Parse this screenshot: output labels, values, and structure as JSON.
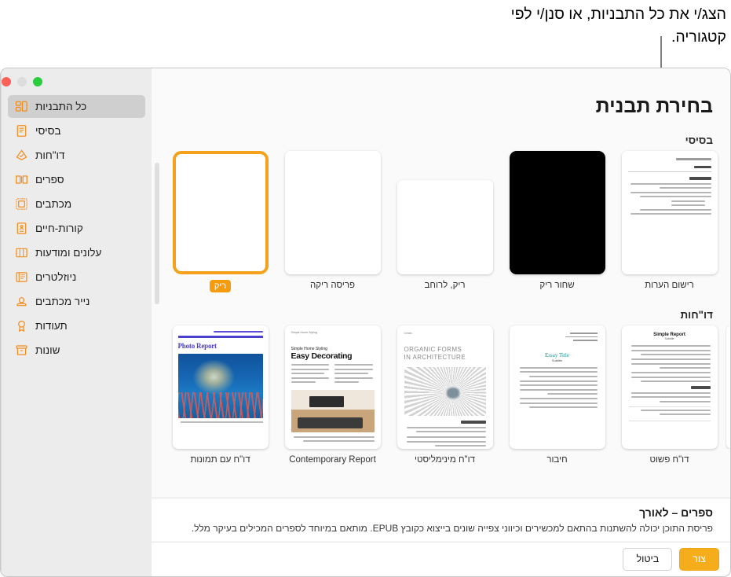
{
  "callout": {
    "text": "הצג/י את כל התבניות, או סנן/י לפי קטגוריה."
  },
  "window": {
    "traffic_lights": {
      "close": "close",
      "minimize": "minimize",
      "zoom": "zoom"
    }
  },
  "sidebar": {
    "items": [
      {
        "label": "כל התבניות",
        "icon": "all-templates-icon",
        "selected": true
      },
      {
        "label": "בסיסי",
        "icon": "basic-document-icon",
        "selected": false
      },
      {
        "label": "דו\"חות",
        "icon": "reports-icon",
        "selected": false
      },
      {
        "label": "ספרים",
        "icon": "books-icon",
        "selected": false
      },
      {
        "label": "מכתבים",
        "icon": "letters-icon",
        "selected": false
      },
      {
        "label": "קורות-חיים",
        "icon": "resume-icon",
        "selected": false
      },
      {
        "label": "עלונים ומודעות",
        "icon": "flyers-posters-icon",
        "selected": false
      },
      {
        "label": "ניוזלטרים",
        "icon": "newsletters-icon",
        "selected": false
      },
      {
        "label": "נייר מכתבים",
        "icon": "stationery-icon",
        "selected": false
      },
      {
        "label": "תעודות",
        "icon": "certificates-icon",
        "selected": false
      },
      {
        "label": "שונות",
        "icon": "miscellaneous-icon",
        "selected": false
      }
    ]
  },
  "main": {
    "title": "בחירת תבנית",
    "sections": [
      {
        "heading": "בסיסי",
        "templates": [
          {
            "label": "רישום הערות",
            "selected": false
          },
          {
            "label": "שחור ריק",
            "selected": false
          },
          {
            "label": "ריק, לרוחב",
            "selected": false
          },
          {
            "label": "פריסה ריקה",
            "selected": false
          },
          {
            "label": "ריק",
            "selected": true
          }
        ]
      },
      {
        "heading": "דו\"חות",
        "templates": [
          {
            "label": "דו\"ח עם תמונות",
            "selected": false
          },
          {
            "label": "Contemporary Report",
            "selected": false
          },
          {
            "label": "דו\"ח מינימליסטי",
            "selected": false
          },
          {
            "label": "חיבור",
            "selected": false
          },
          {
            "label": "דו\"ח פשוט",
            "selected": false
          }
        ]
      }
    ]
  },
  "footer": {
    "title": "ספרים – לאורך",
    "description": "פריסת התוכן יכולה להשתנות בהתאם למכשירים וכיווני צפייה שונים בייצוא כקובץ EPUB. מותאם במיוחד לספרים המכילים בעיקר מלל.",
    "create_label": "צור",
    "cancel_label": "ביטול"
  },
  "colors": {
    "accent_orange": "#f59b0e",
    "sidebar_icon": "#f28c1c",
    "selected_row": "#cfcfcf"
  }
}
